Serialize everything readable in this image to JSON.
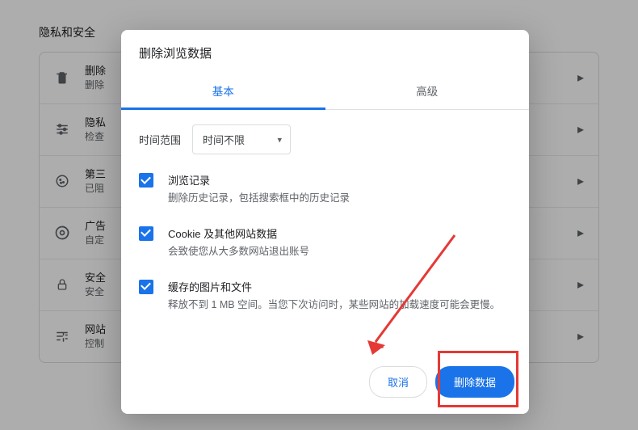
{
  "page": {
    "section_title": "隐私和安全",
    "rows": [
      {
        "title": "删除",
        "subtitle": "删除"
      },
      {
        "title": "隐私",
        "subtitle": "检查"
      },
      {
        "title": "第三",
        "subtitle": "已阻"
      },
      {
        "title": "广告",
        "subtitle": "自定"
      },
      {
        "title": "安全",
        "subtitle": "安全"
      },
      {
        "title": "网站",
        "subtitle": "控制"
      }
    ]
  },
  "dialog": {
    "title": "删除浏览数据",
    "tabs": {
      "basic": "基本",
      "advanced": "高级"
    },
    "time_label": "时间范围",
    "time_value": "时间不限",
    "options": [
      {
        "title": "浏览记录",
        "description": "删除历史记录，包括搜索框中的历史记录"
      },
      {
        "title": "Cookie 及其他网站数据",
        "description": "会致使您从大多数网站退出账号"
      },
      {
        "title": "缓存的图片和文件",
        "description": "释放不到 1 MB 空间。当您下次访问时，某些网站的加载速度可能会更慢。"
      }
    ],
    "buttons": {
      "cancel": "取消",
      "confirm": "删除数据"
    }
  },
  "annotation": {
    "highlight_target": "confirm-button",
    "arrow": true,
    "color": "#e53935"
  }
}
